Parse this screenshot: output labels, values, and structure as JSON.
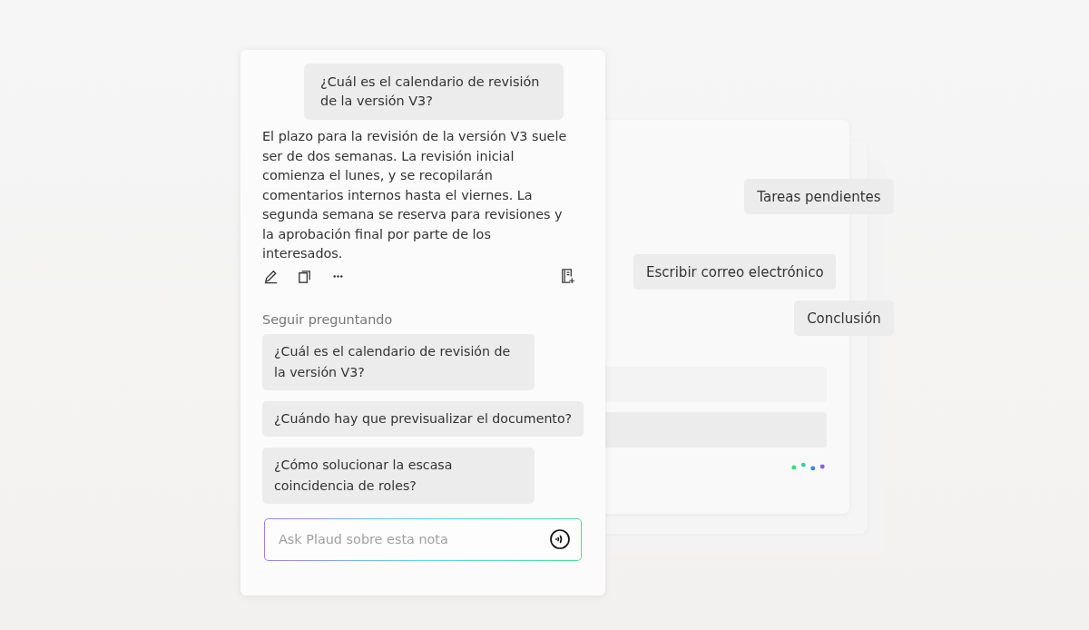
{
  "chat": {
    "question": "¿Cuál es el calendario de revisión de la versión V3?",
    "answer": "El plazo para la revisión de la versión V3 suele ser de dos semanas. La revisión inicial comienza el lunes, y se recopilarán comentarios internos hasta el viernes. La segunda semana se reserva para revisiones y la aprobación final por parte de los interesados.",
    "follow_up_title": "Seguir preguntando",
    "suggestions": [
      "¿Cuál es el calendario de revisión de la versión V3?",
      "¿Cuándo hay que previsualizar el documento?",
      "¿Cómo solucionar la escasa coincidencia de roles?"
    ],
    "input": {
      "placeholder": "Ask Plaud sobre esta nota"
    }
  },
  "background_card": {
    "chips": [
      "Tareas pendientes",
      "Escribir correo electrónico",
      "Conclusión"
    ]
  }
}
